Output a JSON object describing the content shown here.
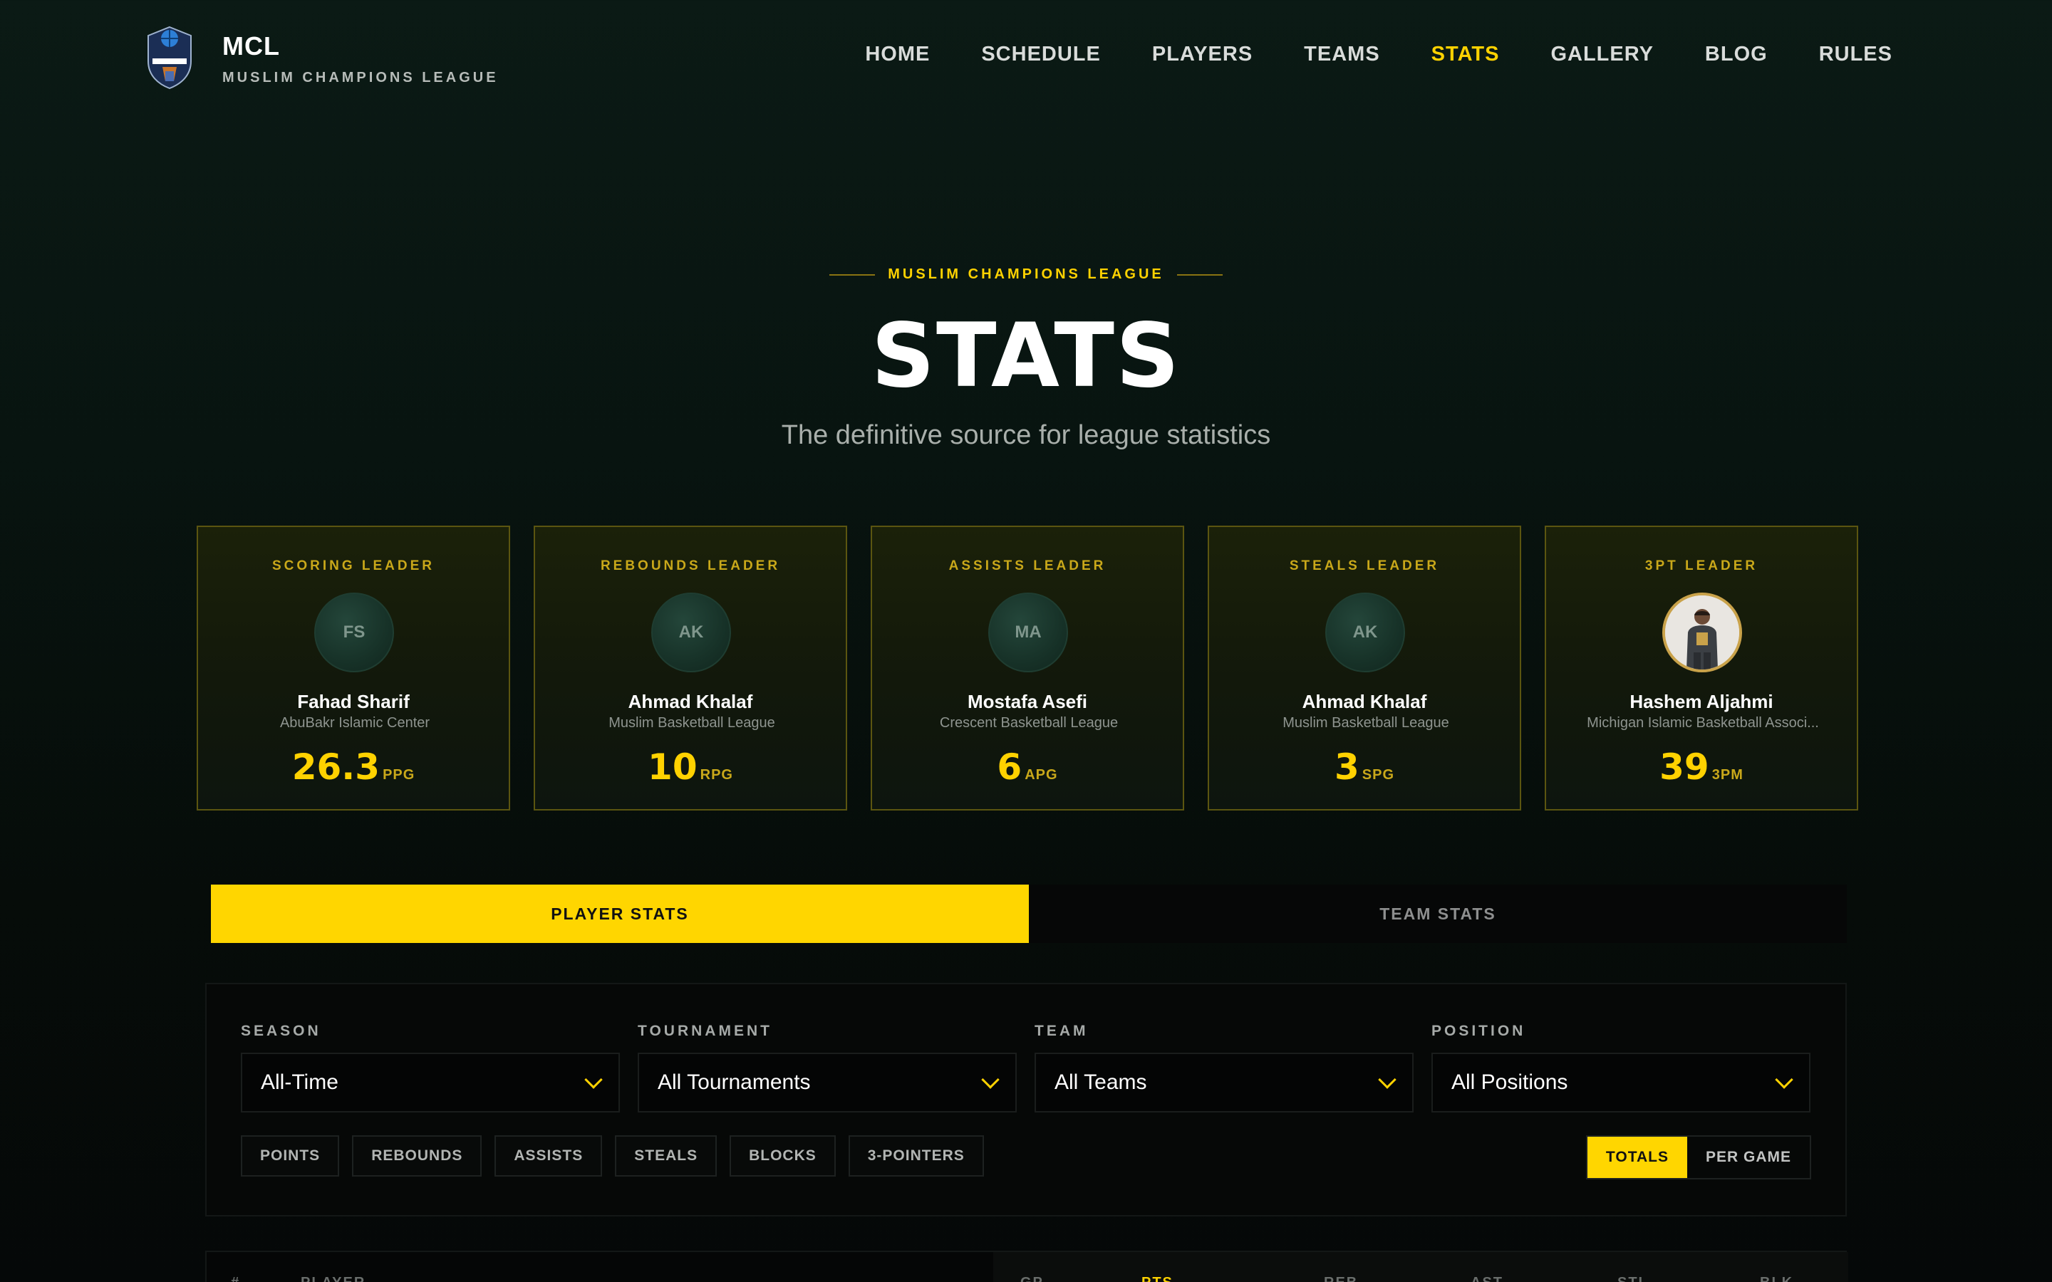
{
  "brand": {
    "name": "MCL",
    "subtitle": "MUSLIM CHAMPIONS LEAGUE"
  },
  "nav": [
    {
      "label": "HOME",
      "active": false
    },
    {
      "label": "SCHEDULE",
      "active": false
    },
    {
      "label": "PLAYERS",
      "active": false
    },
    {
      "label": "TEAMS",
      "active": false
    },
    {
      "label": "STATS",
      "active": true
    },
    {
      "label": "GALLERY",
      "active": false
    },
    {
      "label": "BLOG",
      "active": false
    },
    {
      "label": "RULES",
      "active": false
    }
  ],
  "hero": {
    "eyebrow": "MUSLIM CHAMPIONS LEAGUE",
    "title": "STATS",
    "subtitle": "The definitive source for league statistics"
  },
  "leaders": [
    {
      "label": "SCORING LEADER",
      "initials": "FS",
      "name": "Fahad Sharif",
      "team": "AbuBakr Islamic Center",
      "value": "26.3",
      "unit": "PPG",
      "photo": false
    },
    {
      "label": "REBOUNDS LEADER",
      "initials": "AK",
      "name": "Ahmad Khalaf",
      "team": "Muslim Basketball League",
      "value": "10",
      "unit": "RPG",
      "photo": false
    },
    {
      "label": "ASSISTS LEADER",
      "initials": "MA",
      "name": "Mostafa Asefi",
      "team": "Crescent Basketball League",
      "value": "6",
      "unit": "APG",
      "photo": false
    },
    {
      "label": "STEALS LEADER",
      "initials": "AK",
      "name": "Ahmad Khalaf",
      "team": "Muslim Basketball League",
      "value": "3",
      "unit": "SPG",
      "photo": false
    },
    {
      "label": "3PT LEADER",
      "initials": "",
      "name": "Hashem Aljahmi",
      "team": "Michigan Islamic Basketball Associ...",
      "value": "39",
      "unit": "3PM",
      "photo": true
    }
  ],
  "tabs": [
    {
      "label": "PLAYER STATS",
      "active": true
    },
    {
      "label": "TEAM STATS",
      "active": false
    }
  ],
  "filters": [
    {
      "label": "SEASON",
      "value": "All-Time"
    },
    {
      "label": "TOURNAMENT",
      "value": "All Tournaments"
    },
    {
      "label": "TEAM",
      "value": "All Teams"
    },
    {
      "label": "POSITION",
      "value": "All Positions"
    }
  ],
  "stat_chips": [
    "POINTS",
    "REBOUNDS",
    "ASSISTS",
    "STEALS",
    "BLOCKS",
    "3-POINTERS"
  ],
  "mode_toggle": [
    {
      "label": "TOTALS",
      "active": true
    },
    {
      "label": "PER GAME",
      "active": false
    }
  ],
  "table_headers": [
    "#",
    "PLAYER",
    "GP",
    "PTS",
    "REB",
    "AST",
    "STL",
    "BLK"
  ],
  "colors": {
    "accent": "#ffd200",
    "background": "#0b1a15",
    "card_border": "#5b5510"
  }
}
